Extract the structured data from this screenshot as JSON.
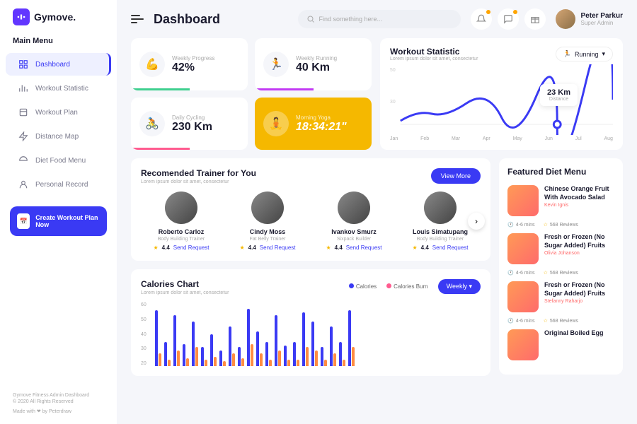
{
  "brand": "Gymove.",
  "menu_label": "Main Menu",
  "nav": [
    "Dashboard",
    "Workout Statistic",
    "Workout Plan",
    "Distance Map",
    "Diet Food Menu",
    "Personal Record"
  ],
  "cta": "Create Workout Plan Now",
  "footer1": "Gymove Fitness Admin Dashboard",
  "footer2": "© 2020 All Rights Reserved",
  "footer3": "Made with ❤ by Peterdraw",
  "page_title": "Dashboard",
  "search_placeholder": "Find something here...",
  "user": {
    "name": "Peter Parkur",
    "role": "Super Admin"
  },
  "stats": [
    {
      "label": "Weekly Progress",
      "value": "42%",
      "icon": "💪",
      "bar": "#3ecf8e"
    },
    {
      "label": "Weekly Running",
      "value": "40 Km",
      "icon": "🏃",
      "bar": "#c23af4"
    },
    {
      "label": "Daily Cycling",
      "value": "230 Km",
      "icon": "🚴",
      "bar": "#ff5b8f"
    },
    {
      "label": "Morning Yoga",
      "value": "18:34:21\"",
      "icon": "🧘",
      "bar": ""
    }
  ],
  "workout": {
    "title": "Workout Statistic",
    "sub": "Lorem ipsum dolor sit amet, consectetur",
    "pill": "Running",
    "tooltip_val": "23 Km",
    "tooltip_lbl": "Distance",
    "months": [
      "Jan",
      "Feb",
      "Mar",
      "Apr",
      "May",
      "Jun",
      "Jul",
      "Aug"
    ]
  },
  "trainers_section": {
    "title": "Recomended Trainer for You",
    "sub": "Lorem ipsum dolor sit amet, consectetur",
    "view_more": "View More",
    "send_request": "Send Request",
    "list": [
      {
        "name": "Roberto Carloz",
        "role": "Body Building Trainer",
        "rating": "4.4"
      },
      {
        "name": "Cindy Moss",
        "role": "Fat Belly Trainer",
        "rating": "4.4"
      },
      {
        "name": "Ivankov Smurz",
        "role": "Sixpack Builder",
        "rating": "4.4"
      },
      {
        "name": "Louis Simatupang",
        "role": "Body Building Trainer",
        "rating": "4.4"
      }
    ]
  },
  "calories": {
    "title": "Calories Chart",
    "sub": "Lorem ipsum dolor sit amet, consectetur",
    "legend1": "Calories",
    "legend2": "Calories Burn",
    "btn": "Weekly",
    "y": [
      "60",
      "50",
      "40",
      "30",
      "20"
    ]
  },
  "chart_data": {
    "type": "bar",
    "ylim": [
      20,
      60
    ],
    "series": [
      {
        "name": "Calories",
        "values": [
          55,
          35,
          52,
          34,
          48,
          32,
          40,
          30,
          45,
          32,
          56,
          42,
          35,
          52,
          33,
          35,
          54,
          48,
          32,
          45,
          35,
          55
        ]
      },
      {
        "name": "Calories Burn",
        "values": [
          28,
          24,
          30,
          25,
          32,
          24,
          26,
          23,
          28,
          25,
          34,
          28,
          24,
          30,
          24,
          24,
          32,
          30,
          24,
          28,
          24,
          32
        ]
      }
    ]
  },
  "diet": {
    "title": "Featured Diet Menu",
    "time": "4-6 mins",
    "reviews": "568 Reviews",
    "items": [
      {
        "title": "Chinese Orange Fruit With Avocado Salad",
        "author": "Kevin Ignis"
      },
      {
        "title": "Fresh or Frozen (No Sugar Added) Fruits",
        "author": "Olivia Johanson"
      },
      {
        "title": "Fresh or Frozen (No Sugar Added) Fruits",
        "author": "Stefanny Raharjo"
      },
      {
        "title": "Original Boiled Egg",
        "author": ""
      }
    ]
  }
}
